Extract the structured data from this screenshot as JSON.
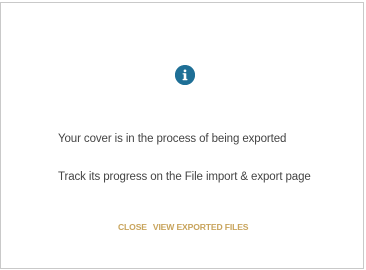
{
  "dialog": {
    "icon": "info-icon",
    "message_primary": "Your cover is in the process of being exported",
    "message_secondary": "Track its progress on the File import & export page",
    "actions": {
      "close_label": "CLOSE",
      "view_label": "VIEW EXPORTED FILES"
    }
  },
  "colors": {
    "icon_bg": "#1e6f96",
    "action_text": "#c8a45c",
    "body_text": "#444444",
    "border": "#c9c9c9"
  }
}
